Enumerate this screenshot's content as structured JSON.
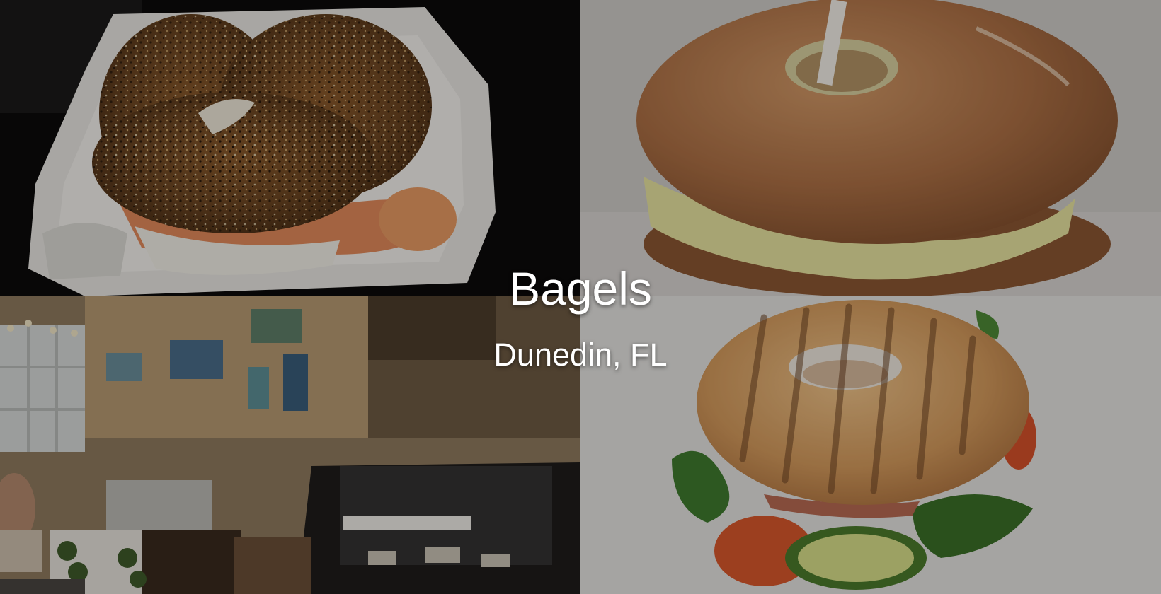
{
  "caption": {
    "title": "Bagels",
    "subtitle": "Dunedin, FL"
  },
  "photos": [
    {
      "subject": "everything bagel with lox in a foam takeout container"
    },
    {
      "subject": "plain bagel breakfast sandwich with scrambled egg"
    },
    {
      "subject": "bagel shop interior with counter and pastry display case"
    },
    {
      "subject": "grilled bagel sandwich with lettuce, tomato and cucumber"
    }
  ],
  "colors": {
    "overlay": "#000000",
    "text": "#ffffff",
    "bagel_crust": "#b77a45",
    "egg": "#e8e3a0",
    "lettuce": "#3f7a2e",
    "tomato": "#d9582c"
  }
}
